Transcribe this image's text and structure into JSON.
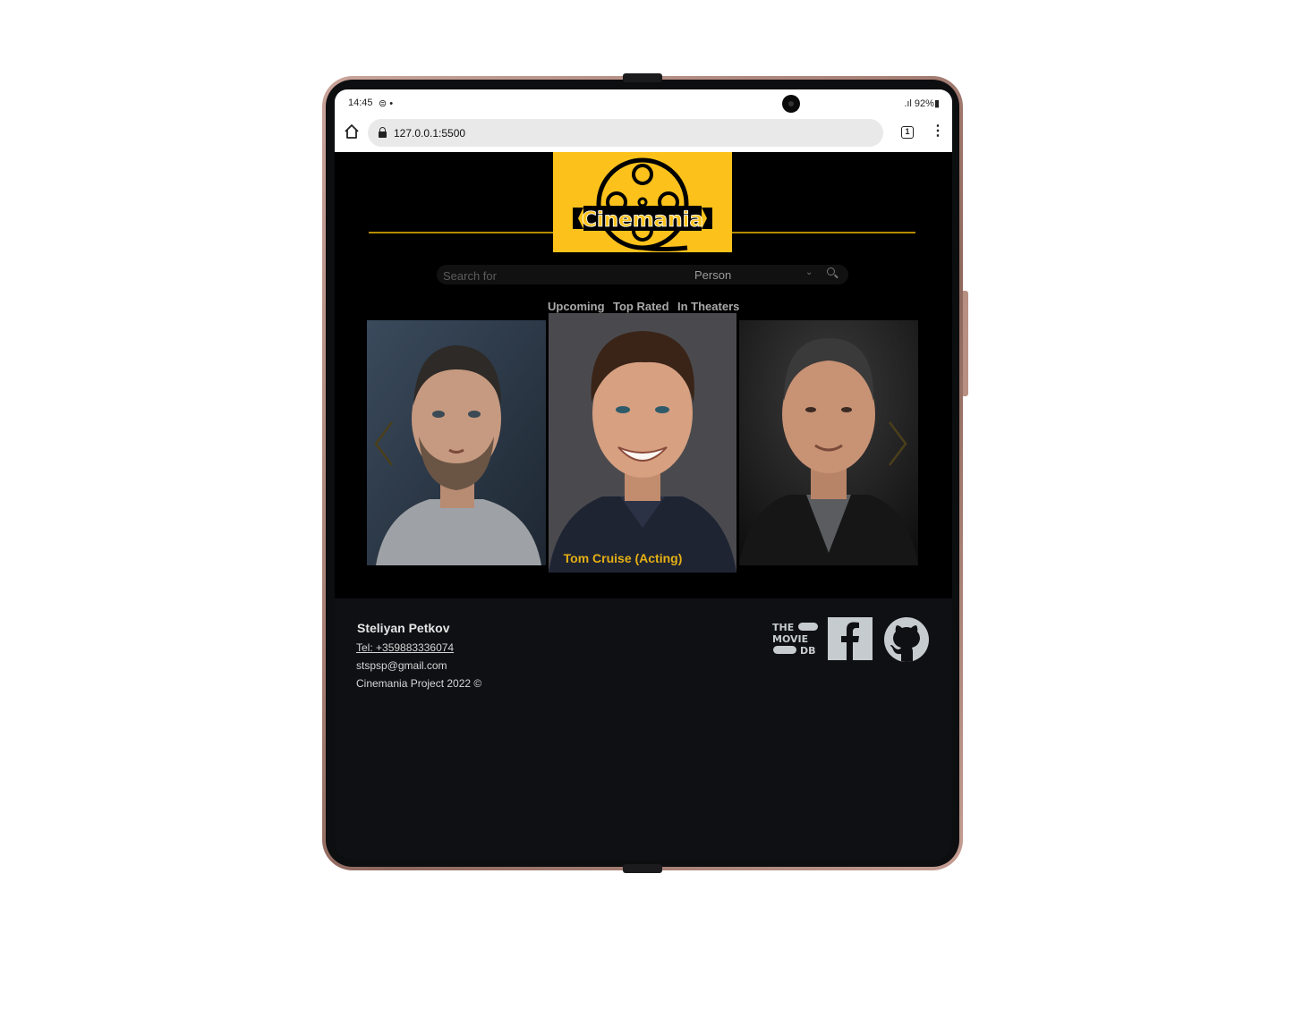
{
  "status_bar": {
    "time": "14:45",
    "extra": "⊜ •",
    "right": ".ıl 92%▮"
  },
  "browser": {
    "url": "127.0.0.1:5500",
    "tab_count": "1"
  },
  "header": {
    "logo_text": "Cinemania",
    "brand_color": "#fcc21b",
    "accent_line_color": "#b38b00"
  },
  "search": {
    "placeholder": "Search for",
    "category": "Person"
  },
  "nav": {
    "tabs": [
      {
        "label": "Upcoming"
      },
      {
        "label": "Top Rated"
      },
      {
        "label": "In Theaters"
      }
    ]
  },
  "carousel": {
    "active_caption": "Tom Cruise (Acting)"
  },
  "footer": {
    "name": "Steliyan Petkov",
    "tel": "Tel: +359883336074",
    "email": "stspsp@gmail.com",
    "copyright": "Cinemania Project 2022 ©",
    "tmdb_lines": [
      "THE",
      "MOVIE",
      "DB"
    ]
  }
}
